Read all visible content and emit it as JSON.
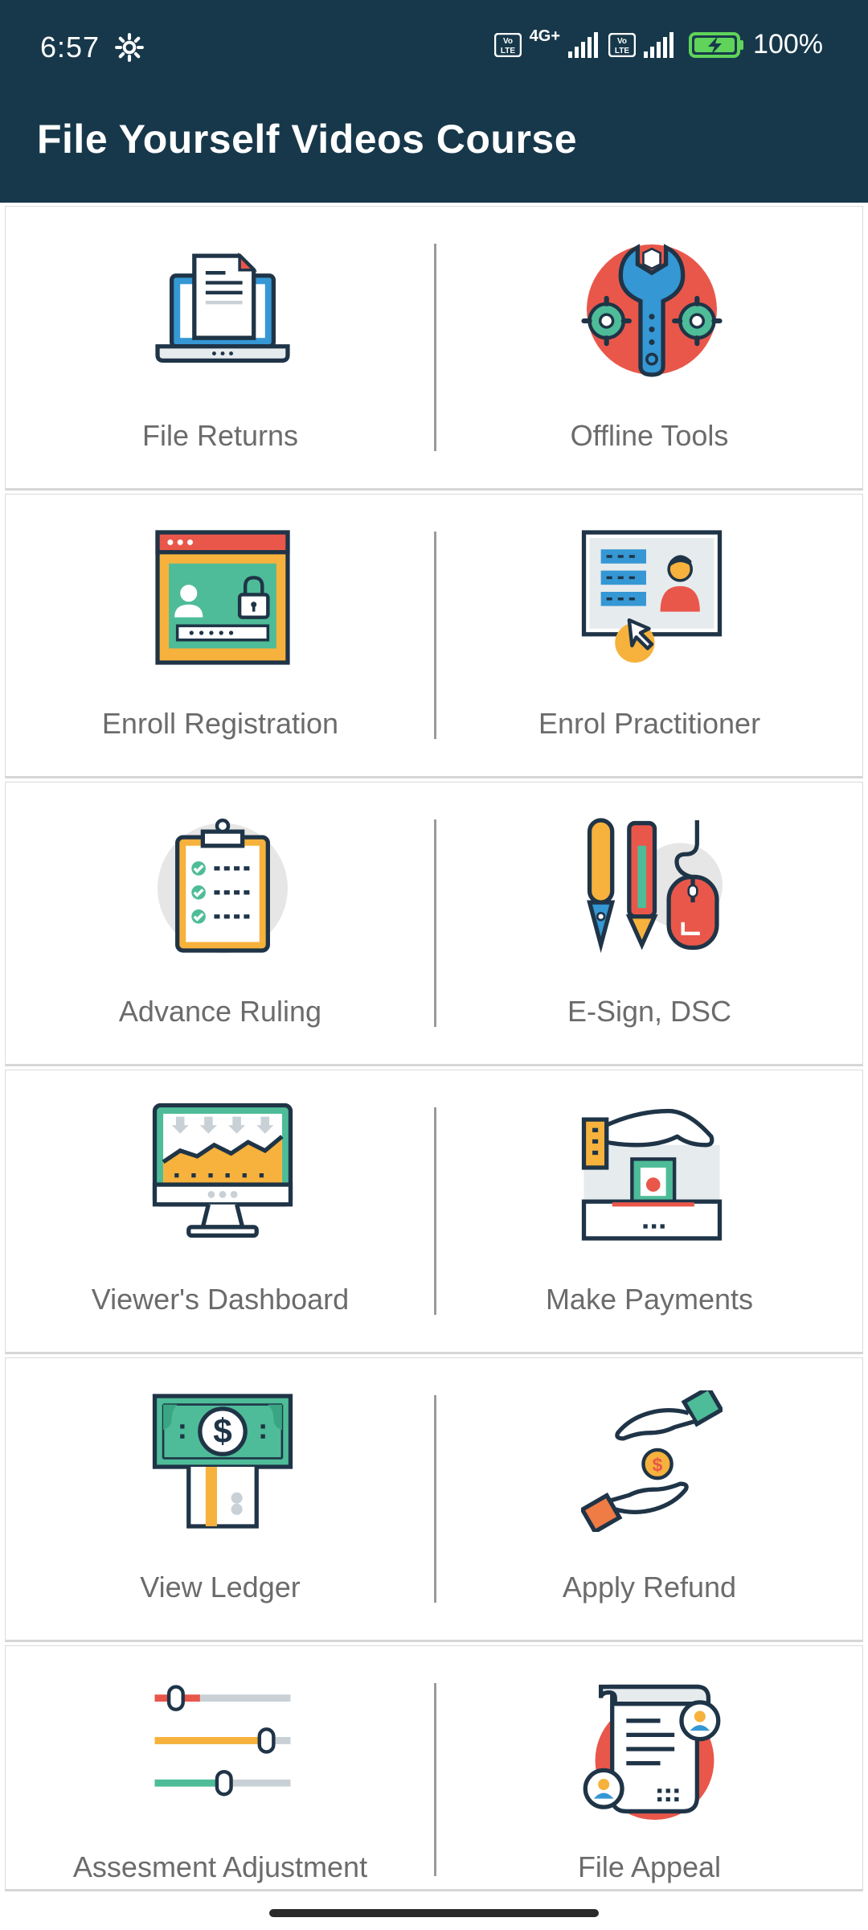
{
  "status_bar": {
    "time": "6:57",
    "network_1": "4G+",
    "battery": "100%",
    "icons": [
      "settings-gear-icon",
      "volte-icon",
      "signal-icon",
      "battery-charging-icon"
    ]
  },
  "app_bar": {
    "title": "File Yourself Videos Course"
  },
  "menu": [
    {
      "label": "File Returns",
      "icon": "laptop-document-icon"
    },
    {
      "label": "Offline Tools",
      "icon": "wrench-gears-icon"
    },
    {
      "label": "Enroll Registration",
      "icon": "secure-login-window-icon"
    },
    {
      "label": "Enrol Practitioner",
      "icon": "profile-board-icon"
    },
    {
      "label": "Advance Ruling",
      "icon": "clipboard-checklist-icon"
    },
    {
      "label": "E-Sign, DSC",
      "icon": "pen-pencil-mouse-icon"
    },
    {
      "label": "Viewer's Dashboard",
      "icon": "monitor-chart-icon"
    },
    {
      "label": "Make Payments",
      "icon": "hand-payment-icon"
    },
    {
      "label": "View Ledger",
      "icon": "dollar-bill-board-icon"
    },
    {
      "label": "Apply Refund",
      "icon": "hands-coin-exchange-icon"
    },
    {
      "label": "Assesment Adjustment",
      "icon": "sliders-icon"
    },
    {
      "label": "File Appeal",
      "icon": "scroll-document-users-icon"
    }
  ],
  "colors": {
    "app_bar": "#17384a",
    "navy": "#1f3447",
    "red": "#e9574a",
    "blue": "#3597d4",
    "teal": "#4ebc98",
    "orange": "#f6b23c",
    "label": "#6b6b6b"
  }
}
